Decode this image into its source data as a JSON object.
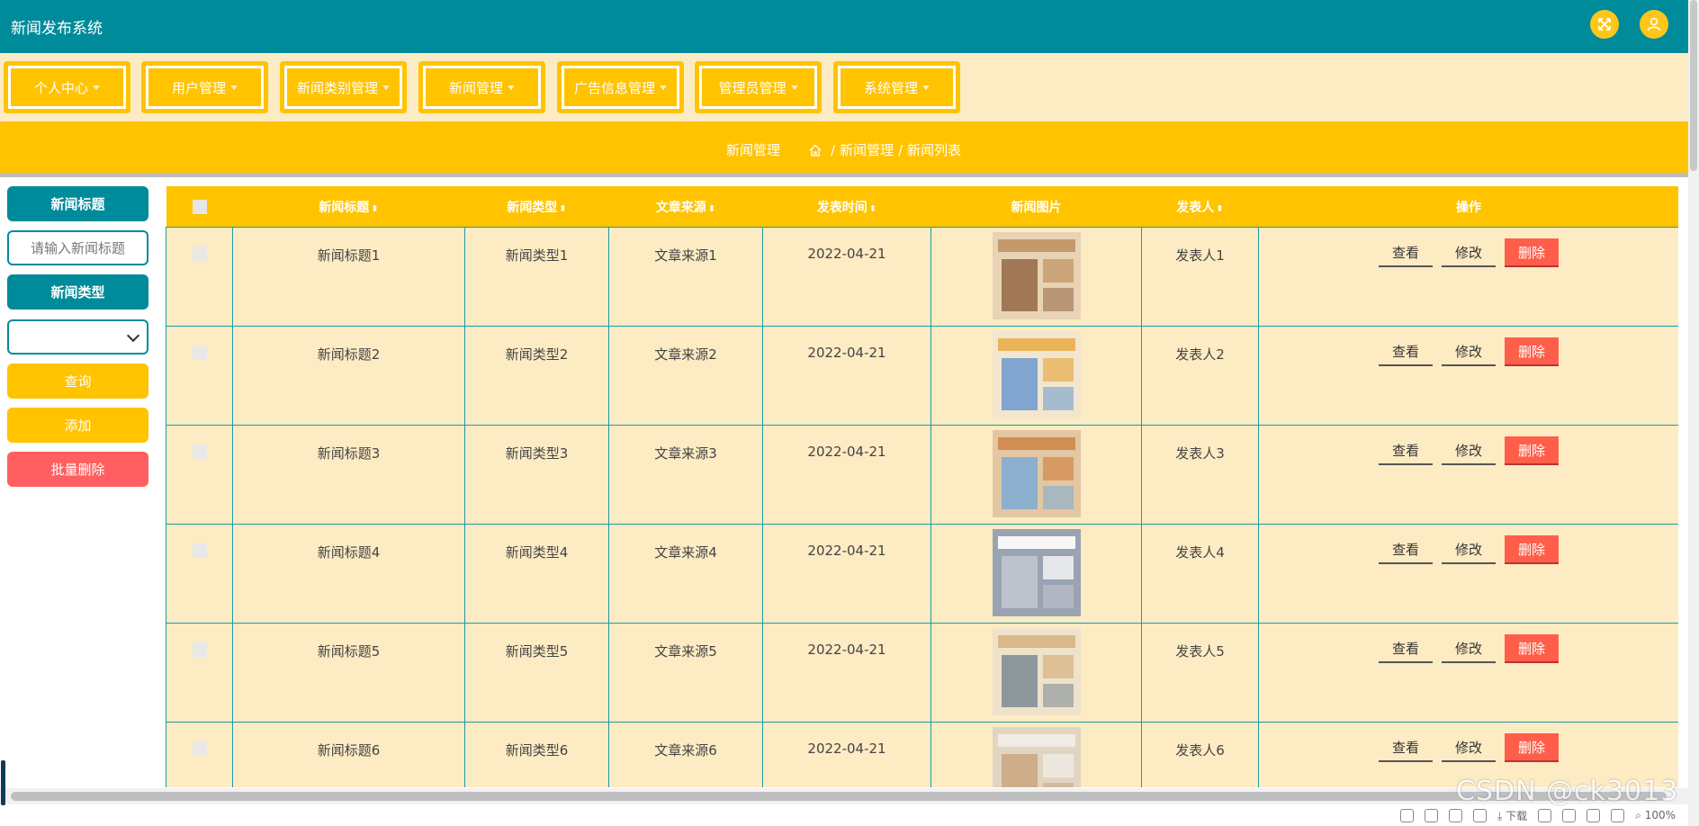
{
  "app": {
    "title": "新闻发布系统"
  },
  "nav": {
    "items": [
      {
        "label": "个人中心"
      },
      {
        "label": "用户管理"
      },
      {
        "label": "新闻类别管理"
      },
      {
        "label": "新闻管理"
      },
      {
        "label": "广告信息管理"
      },
      {
        "label": "管理员管理"
      },
      {
        "label": "系统管理"
      }
    ]
  },
  "breadcrumb": {
    "title": "新闻管理",
    "items": [
      "新闻管理",
      "新闻列表"
    ]
  },
  "sidebar": {
    "title_label": "新闻标题",
    "title_placeholder": "请输入新闻标题",
    "type_label": "新闻类型",
    "type_selected": "",
    "search_button": "查询",
    "add_button": "添加",
    "batch_delete_button": "批量删除"
  },
  "table": {
    "columns": [
      "新闻标题",
      "新闻类型",
      "文章来源",
      "发表时间",
      "新闻图片",
      "发表人",
      "操作"
    ],
    "rows": [
      {
        "title": "新闻标题1",
        "type": "新闻类型1",
        "source": "文章来源1",
        "time": "2022-04-21",
        "author": "发表人1"
      },
      {
        "title": "新闻标题2",
        "type": "新闻类型2",
        "source": "文章来源2",
        "time": "2022-04-21",
        "author": "发表人2"
      },
      {
        "title": "新闻标题3",
        "type": "新闻类型3",
        "source": "文章来源3",
        "time": "2022-04-21",
        "author": "发表人3"
      },
      {
        "title": "新闻标题4",
        "type": "新闻类型4",
        "source": "文章来源4",
        "time": "2022-04-21",
        "author": "发表人4"
      },
      {
        "title": "新闻标题5",
        "type": "新闻类型5",
        "source": "文章来源5",
        "time": "2022-04-21",
        "author": "发表人5"
      },
      {
        "title": "新闻标题6",
        "type": "新闻类型6",
        "source": "文章来源6",
        "time": "2022-04-21",
        "author": "发表人6"
      }
    ],
    "actions": {
      "view": "查看",
      "edit": "修改",
      "delete": "删除"
    }
  },
  "statusbar": {
    "download": "下载",
    "zoom": "100%"
  },
  "watermark": "CSDN @ck3013",
  "colors": {
    "primary": "#008b9b",
    "accent": "#ffc300",
    "row_bg": "#fdebc3",
    "danger": "#ff5f4a"
  }
}
